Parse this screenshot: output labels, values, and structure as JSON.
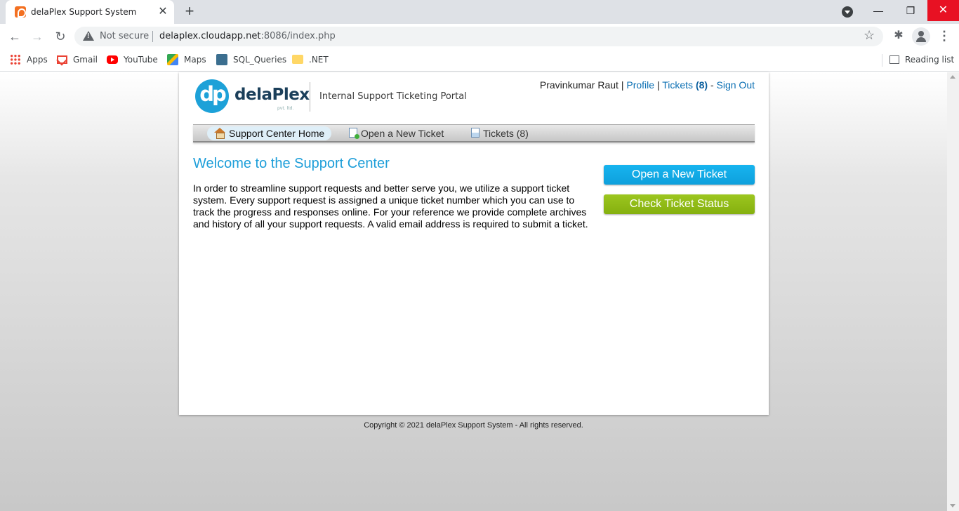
{
  "browser": {
    "tab_title": "delaPlex Support System",
    "tab_close": "✕",
    "new_tab": "+",
    "security_label": "Not secure",
    "url_host": "delaplex.cloudapp.net",
    "url_rest": ":8086/index.php",
    "bookmarks": [
      {
        "label": "Apps",
        "icon": "apps-icon"
      },
      {
        "label": "Gmail",
        "icon": "gmail-icon"
      },
      {
        "label": "YouTube",
        "icon": "youtube-icon"
      },
      {
        "label": "Maps",
        "icon": "maps-icon"
      },
      {
        "label": "SQL_Queries",
        "icon": "sql-icon"
      },
      {
        "label": ".NET",
        "icon": "folder-icon"
      }
    ],
    "reading_list": "Reading list"
  },
  "header": {
    "brand": "delaPlex",
    "brand_sub": "pvt. ltd.",
    "portal_title": "Internal Support Ticketing Portal",
    "user_name": "Pravinkumar Raut",
    "separator": "|",
    "profile_link": "Profile",
    "tickets_link": "Tickets",
    "tickets_count": "(8)",
    "dash": "-",
    "signout_link": "Sign Out"
  },
  "nav": {
    "home": "Support Center Home",
    "new_ticket": "Open a New Ticket",
    "tickets": "Tickets (8)"
  },
  "main": {
    "heading": "Welcome to the Support Center",
    "intro": "In order to streamline support requests and better serve you, we utilize a support ticket system. Every support request is assigned a unique ticket number which you can use to track the progress and responses online. For your reference we provide complete archives and history of all your support requests. A valid email address is required to submit a ticket.",
    "open_ticket_button": "Open a New Ticket",
    "check_status_button": "Check Ticket Status"
  },
  "footer": {
    "copyright": "Copyright © 2021 delaPlex Support System - All rights reserved."
  },
  "colors": {
    "link": "#0b6fb3",
    "heading": "#1d9ed9",
    "button_blue": "#0ea0dc",
    "button_green": "#85b00f",
    "close_red": "#e81123"
  }
}
